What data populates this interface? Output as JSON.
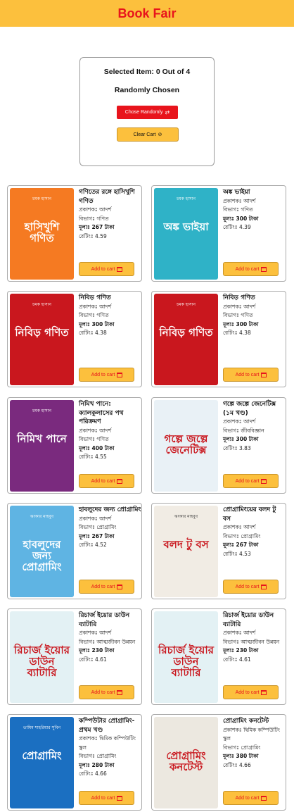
{
  "header": {
    "title": "Book Fair"
  },
  "panel": {
    "selected_text": "Selected Item: 0 Out of 4",
    "random_text": "Randomly Chosen",
    "choose_label": "Chose Randomly",
    "clear_label": "Clear Cart"
  },
  "colors": {
    "brand_yellow": "#fcc03d",
    "brand_red": "#e8141c"
  },
  "add_label": "Add to cart",
  "books": [
    {
      "title": "গণিতের রঙ্গে হাসিখুশি গণিত",
      "publisher": "প্রকাশকঃ আদর্শ",
      "category": "বিভাগঃ গণিত",
      "price": "মূল্যঃ 267 টাকা",
      "rating": "রেটিংঃ 4.59",
      "cover_bg": "#f57a22",
      "cover_text": "হাসিখুশি গণিত",
      "cover_author": "চমক হাসান"
    },
    {
      "title": "অঙ্ক ভাইয়া",
      "publisher": "প্রকাশকঃ আদর্শ",
      "category": "বিভাগঃ গণিত",
      "price": "মূল্যঃ 300 টাকা",
      "rating": "রেটিংঃ 4.39",
      "cover_bg": "#2fb2c7",
      "cover_text": "অঙ্ক ভাইয়া",
      "cover_author": "চমক হাসান"
    },
    {
      "title": "নিবিড় গণিত",
      "publisher": "প্রকাশকঃ আদর্শ",
      "category": "বিভাগঃ গণিত",
      "price": "মূল্যঃ 300 টাকা",
      "rating": "রেটিংঃ 4.38",
      "cover_bg": "#c9171e",
      "cover_text": "নিবিড় গণিত",
      "cover_author": "চমক হাসান"
    },
    {
      "title": "নিবিড় গণিত",
      "publisher": "প্রকাশকঃ আদর্শ",
      "category": "বিভাগঃ গণিত",
      "price": "মূল্যঃ 300 টাকা",
      "rating": "রেটিংঃ 4.38",
      "cover_bg": "#c9171e",
      "cover_text": "নিবিড় গণিত",
      "cover_author": "চমক হাসান"
    },
    {
      "title": "নিমিখ পানে: ক্যালকুলাসের পথ পরিক্রমণ",
      "publisher": "প্রকাশকঃ আদর্শ",
      "category": "বিভাগঃ গণিত",
      "price": "মূল্যঃ 400 টাকা",
      "rating": "রেটিংঃ 4.55",
      "cover_bg": "#7a2a7e",
      "cover_text": "নিমিখ পানে",
      "cover_author": "চমক হাসান"
    },
    {
      "title": "গল্পে জল্পে জেনেটিক্স (১ম খণ্ড)",
      "publisher": "প্রকাশকঃ আদর্শ",
      "category": "বিভাগঃ জীববিজ্ঞান",
      "price": "মূল্যঃ 300 টাকা",
      "rating": "রেটিংঃ 3.83",
      "cover_bg": "#e9f1f6",
      "cover_text": "গল্পে জল্পে জেনেটিক্স",
      "cover_author": ""
    },
    {
      "title": "হাবলুদের জন্য প্রোগ্রামিং",
      "publisher": "প্রকাশকঃ আদর্শ",
      "category": "বিভাগঃ প্রোগ্রামিং",
      "price": "মূল্যঃ 267 টাকা",
      "rating": "রেটিংঃ 4.52",
      "cover_bg": "#5fb4e3",
      "cover_text": "হাবলুদের জন্য প্রোগ্রামিং",
      "cover_author": "ঝংকার মাহবুব"
    },
    {
      "title": "প্রোগ্রামিংয়ের বলদ টু বস",
      "publisher": "প্রকাশকঃ আদর্শ",
      "category": "বিভাগঃ প্রোগ্রামিং",
      "price": "মূল্যঃ 267 টাকা",
      "rating": "রেটিংঃ 4.53",
      "cover_bg": "#f1ece4",
      "cover_text": "বলদ টু বস",
      "cover_author": "ঝংকার মাহবুব"
    },
    {
      "title": "রিচার্জ ইয়োর ডাউন ব্যাটারি",
      "publisher": "প্রকাশকঃ আদর্শ",
      "category": "বিভাগঃ আত্মজীবন উন্নয়ন",
      "price": "মূল্যঃ 230 টাকা",
      "rating": "রেটিংঃ 4.61",
      "cover_bg": "#e3f1f4",
      "cover_text": "রিচার্জ ইয়োর ডাউন ব্যাটারি",
      "cover_author": ""
    },
    {
      "title": "রিচার্জ ইয়োর ডাউন ব্যাটারি",
      "publisher": "প্রকাশকঃ আদর্শ",
      "category": "বিভাগঃ আত্মজীবন উন্নয়ন",
      "price": "মূল্যঃ 230 টাকা",
      "rating": "রেটিংঃ 4.61",
      "cover_bg": "#e3f1f4",
      "cover_text": "রিচার্জ ইয়োর ডাউন ব্যাটারি",
      "cover_author": ""
    },
    {
      "title": "কম্পিউটার প্রোগ্রামিং-প্রথম খণ্ড",
      "publisher": "প্রকাশকঃ দ্বিমিক কম্পিউটিং স্কুল",
      "category": "বিভাগঃ প্রোগ্রামিং",
      "price": "মূল্যঃ 280 টাকা",
      "rating": "রেটিংঃ 4.66",
      "cover_bg": "#1b6fc1",
      "cover_text": "প্রোগ্রামিং",
      "cover_author": "তামিম শাহরিয়ার সুবিন"
    },
    {
      "title": "প্রোগ্রামিং কনটেস্ট",
      "publisher": "প্রকাশকঃ দ্বিমিক কম্পিউটিং স্কুল",
      "category": "বিভাগঃ প্রোগ্রামিং",
      "price": "মূল্যঃ 380 টাকা",
      "rating": "রেটিংঃ 4.66",
      "cover_bg": "#ece8e0",
      "cover_text": "প্রোগ্রামিং কনটেস্ট",
      "cover_author": ""
    }
  ]
}
